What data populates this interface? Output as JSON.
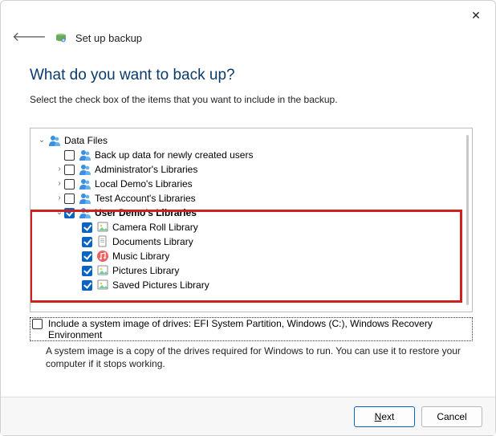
{
  "titlebar": {
    "title": "Set up backup"
  },
  "heading": "What do you want to back up?",
  "instruction": "Select the check box of the items that you want to include in the backup.",
  "tree": {
    "root": {
      "label": "Data Files"
    },
    "items": [
      {
        "label": "Back up data for newly created users"
      },
      {
        "label": "Administrator's Libraries"
      },
      {
        "label": "Local Demo's Libraries"
      },
      {
        "label": "Test Account's Libraries"
      },
      {
        "label": "User Demo's Libraries"
      }
    ],
    "userdemo_children": [
      {
        "label": "Camera Roll Library"
      },
      {
        "label": "Documents Library"
      },
      {
        "label": "Music Library"
      },
      {
        "label": "Pictures Library"
      },
      {
        "label": "Saved Pictures Library"
      }
    ]
  },
  "system_image": {
    "label": "Include a system image of drives: EFI System Partition, Windows (C:), Windows Recovery Environment",
    "note": "A system image is a copy of the drives required for Windows to run. You can use it to restore your computer if it stops working."
  },
  "buttons": {
    "next": "Next",
    "cancel": "Cancel"
  }
}
